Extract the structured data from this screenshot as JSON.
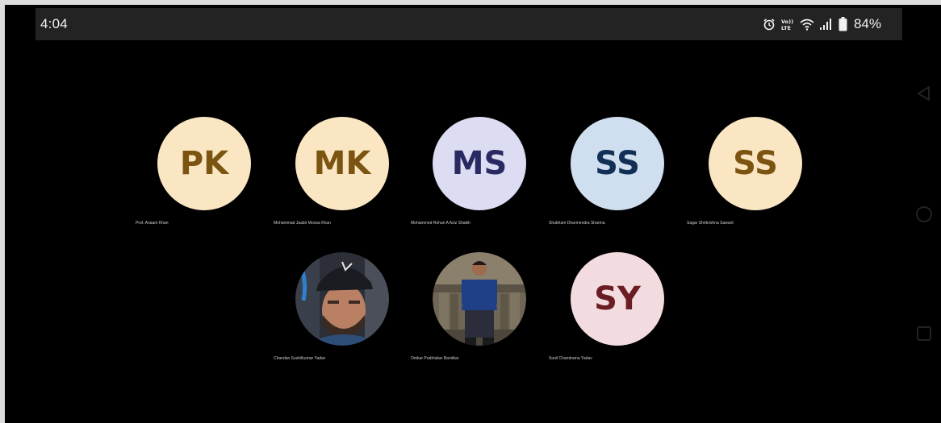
{
  "status_bar": {
    "time": "4:04",
    "battery_percent": "84%",
    "icons": [
      "alarm-icon",
      "volte-icon",
      "wifi-icon",
      "cell-signal-icon",
      "battery-icon"
    ],
    "volte_label": "Vo))\nLTE"
  },
  "participants": [
    {
      "initials": "PK",
      "name": "Prof. Anaam Khan",
      "bg": "#fbe6c3",
      "fg": "#7a5410"
    },
    {
      "initials": "MK",
      "name": "Mohammad Jaabir Moosa Khan",
      "bg": "#fbe6c3",
      "fg": "#7a5410"
    },
    {
      "initials": "MS",
      "name": "Mohammed Rehan A Aziz Shaikh",
      "bg": "#dcdcf2",
      "fg": "#2a2a63"
    },
    {
      "initials": "SS",
      "name": "Shubham Dharmendra Sharma",
      "bg": "#cfdff0",
      "fg": "#123056"
    },
    {
      "initials": "SS",
      "name": "Sagar Shrikrishna Sawant",
      "bg": "#fbe6c3",
      "fg": "#7a5410"
    },
    {
      "initials": "",
      "name": "Chandan Sushilkumar Yadav",
      "photo": "photo-portrait-cap"
    },
    {
      "initials": "",
      "name": "Omkar Prabhakar Bandkar",
      "photo": "photo-standing-person"
    },
    {
      "initials": "SY",
      "name": "Sunil Chandrama Yadav",
      "bg": "#f3dcdf",
      "fg": "#6b1d24"
    }
  ],
  "nav": {
    "back_icon": "back-triangle-icon",
    "home_icon": "home-circle-icon",
    "recents_icon": "recents-square-icon"
  }
}
